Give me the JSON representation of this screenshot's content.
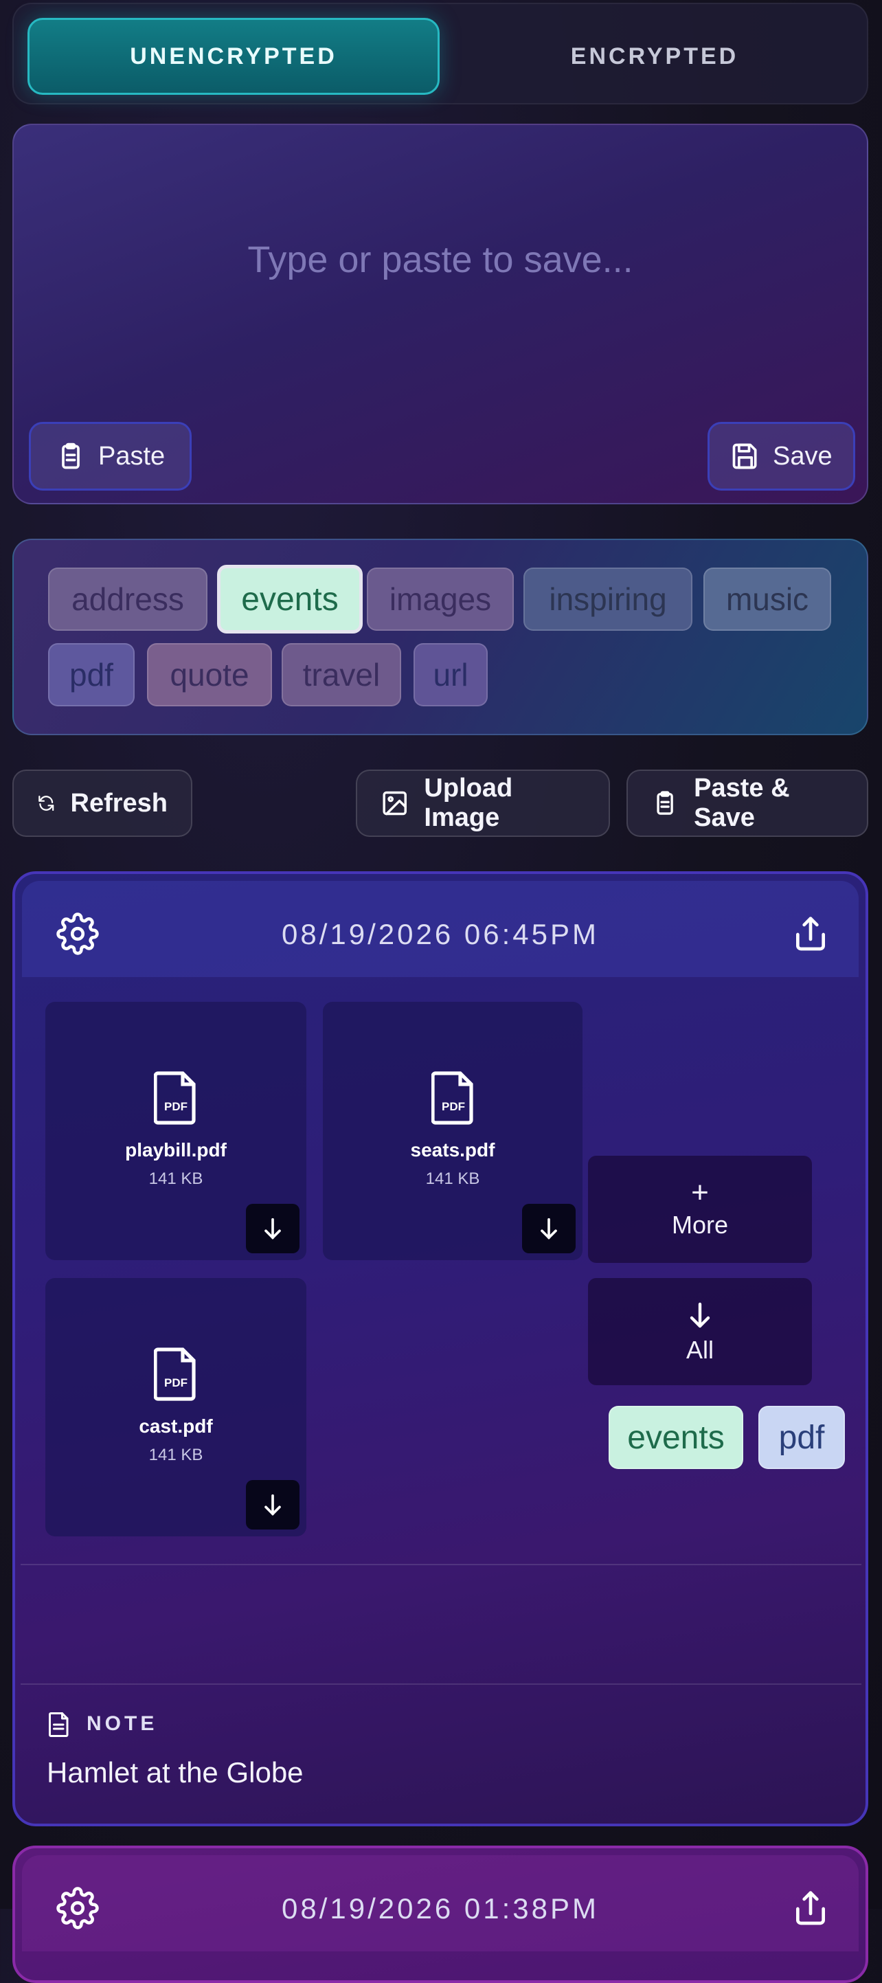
{
  "mode_tabs": {
    "unencrypted": "UNENCRYPTED",
    "encrypted": "ENCRYPTED"
  },
  "composer": {
    "placeholder": "Type or paste to save...",
    "paste_label": "Paste",
    "save_label": "Save"
  },
  "tag_filters": [
    {
      "label": "address",
      "selected": false,
      "color": "#6c5d8e"
    },
    {
      "label": "events",
      "selected": true,
      "color": "#c9f1e0"
    },
    {
      "label": "images",
      "selected": false,
      "color": "#6a5a8e"
    },
    {
      "label": "inspiring",
      "selected": false,
      "color": "#4d5b8a"
    },
    {
      "label": "music",
      "selected": false,
      "color": "#566a93"
    },
    {
      "label": "pdf",
      "selected": false,
      "color": "#5e589e"
    },
    {
      "label": "quote",
      "selected": false,
      "color": "#7a5f8d"
    },
    {
      "label": "travel",
      "selected": false,
      "color": "#6e5a8c"
    },
    {
      "label": "url",
      "selected": false,
      "color": "#5f5496"
    }
  ],
  "actions": {
    "refresh": "Refresh",
    "upload_image": "Upload Image",
    "paste_save": "Paste & Save"
  },
  "cards": [
    {
      "timestamp": "08/19/2026 06:45PM",
      "files": [
        {
          "name": "playbill.pdf",
          "size": "141 KB"
        },
        {
          "name": "seats.pdf",
          "size": "141 KB"
        },
        {
          "name": "cast.pdf",
          "size": "141 KB"
        }
      ],
      "more_label": "More",
      "more_glyph": "+",
      "all_label": "All",
      "tags": [
        {
          "label": "events",
          "color": "#c9f1e0",
          "text_color": "#1e6b4b"
        },
        {
          "label": "pdf",
          "color": "#c9d6f3",
          "text_color": "#2a3f7a"
        }
      ],
      "note_label": "NOTE",
      "note_text": "Hamlet at the Globe"
    },
    {
      "timestamp": "08/19/2026 01:38PM"
    }
  ]
}
